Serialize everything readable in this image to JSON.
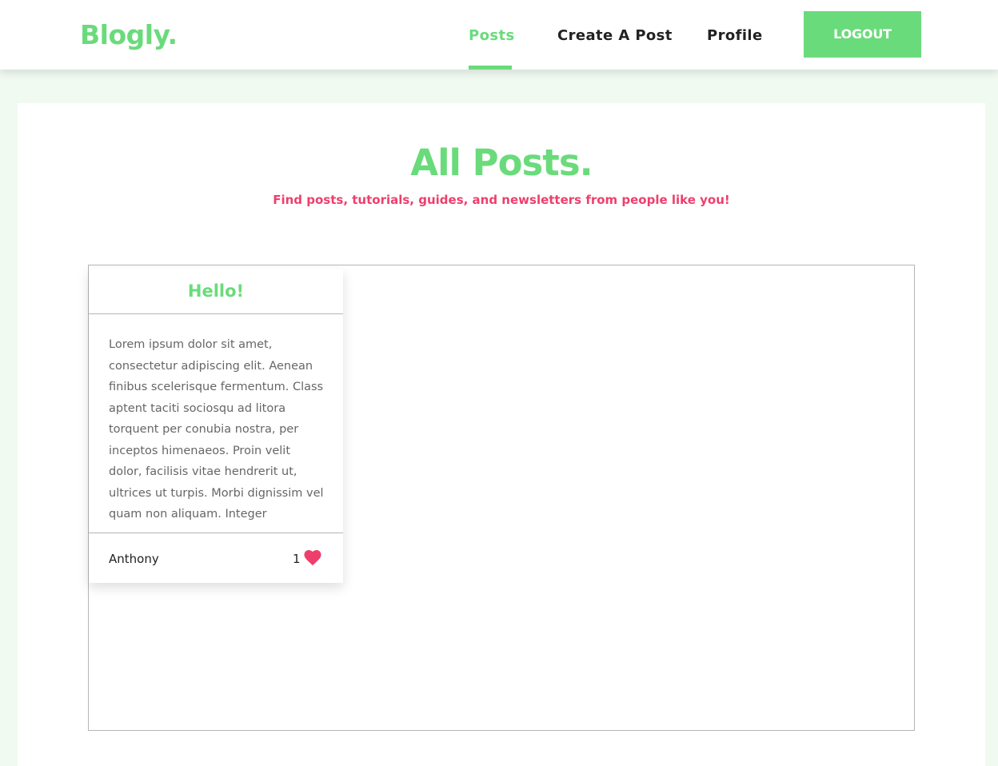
{
  "navbar": {
    "brand": "Blogly.",
    "links": [
      {
        "label": "Posts",
        "active": true
      },
      {
        "label": "Create A Post",
        "active": false
      },
      {
        "label": "Profile",
        "active": false
      }
    ],
    "logout_label": "LOGOUT"
  },
  "main": {
    "title": "All Posts.",
    "subtitle": "Find posts, tutorials, guides, and newsletters from people like you!",
    "posts": [
      {
        "title": "Hello!",
        "body": "Lorem ipsum dolor sit amet, consectetur adipiscing elit. Aenean finibus scelerisque fermentum. Class aptent taciti sociosqu ad litora torquent per conubia nostra, per inceptos himenaeos. Proin velit dolor, facilisis vitae hendrerit ut, ultrices ut turpis. Morbi dignissim vel quam non aliquam. Integer",
        "author": "Anthony",
        "likes": "1",
        "like_icon": "heart-icon"
      }
    ]
  },
  "colors": {
    "accent": "#6adb7b",
    "highlight": "#ee3f6c",
    "background": "#f0faf1"
  }
}
